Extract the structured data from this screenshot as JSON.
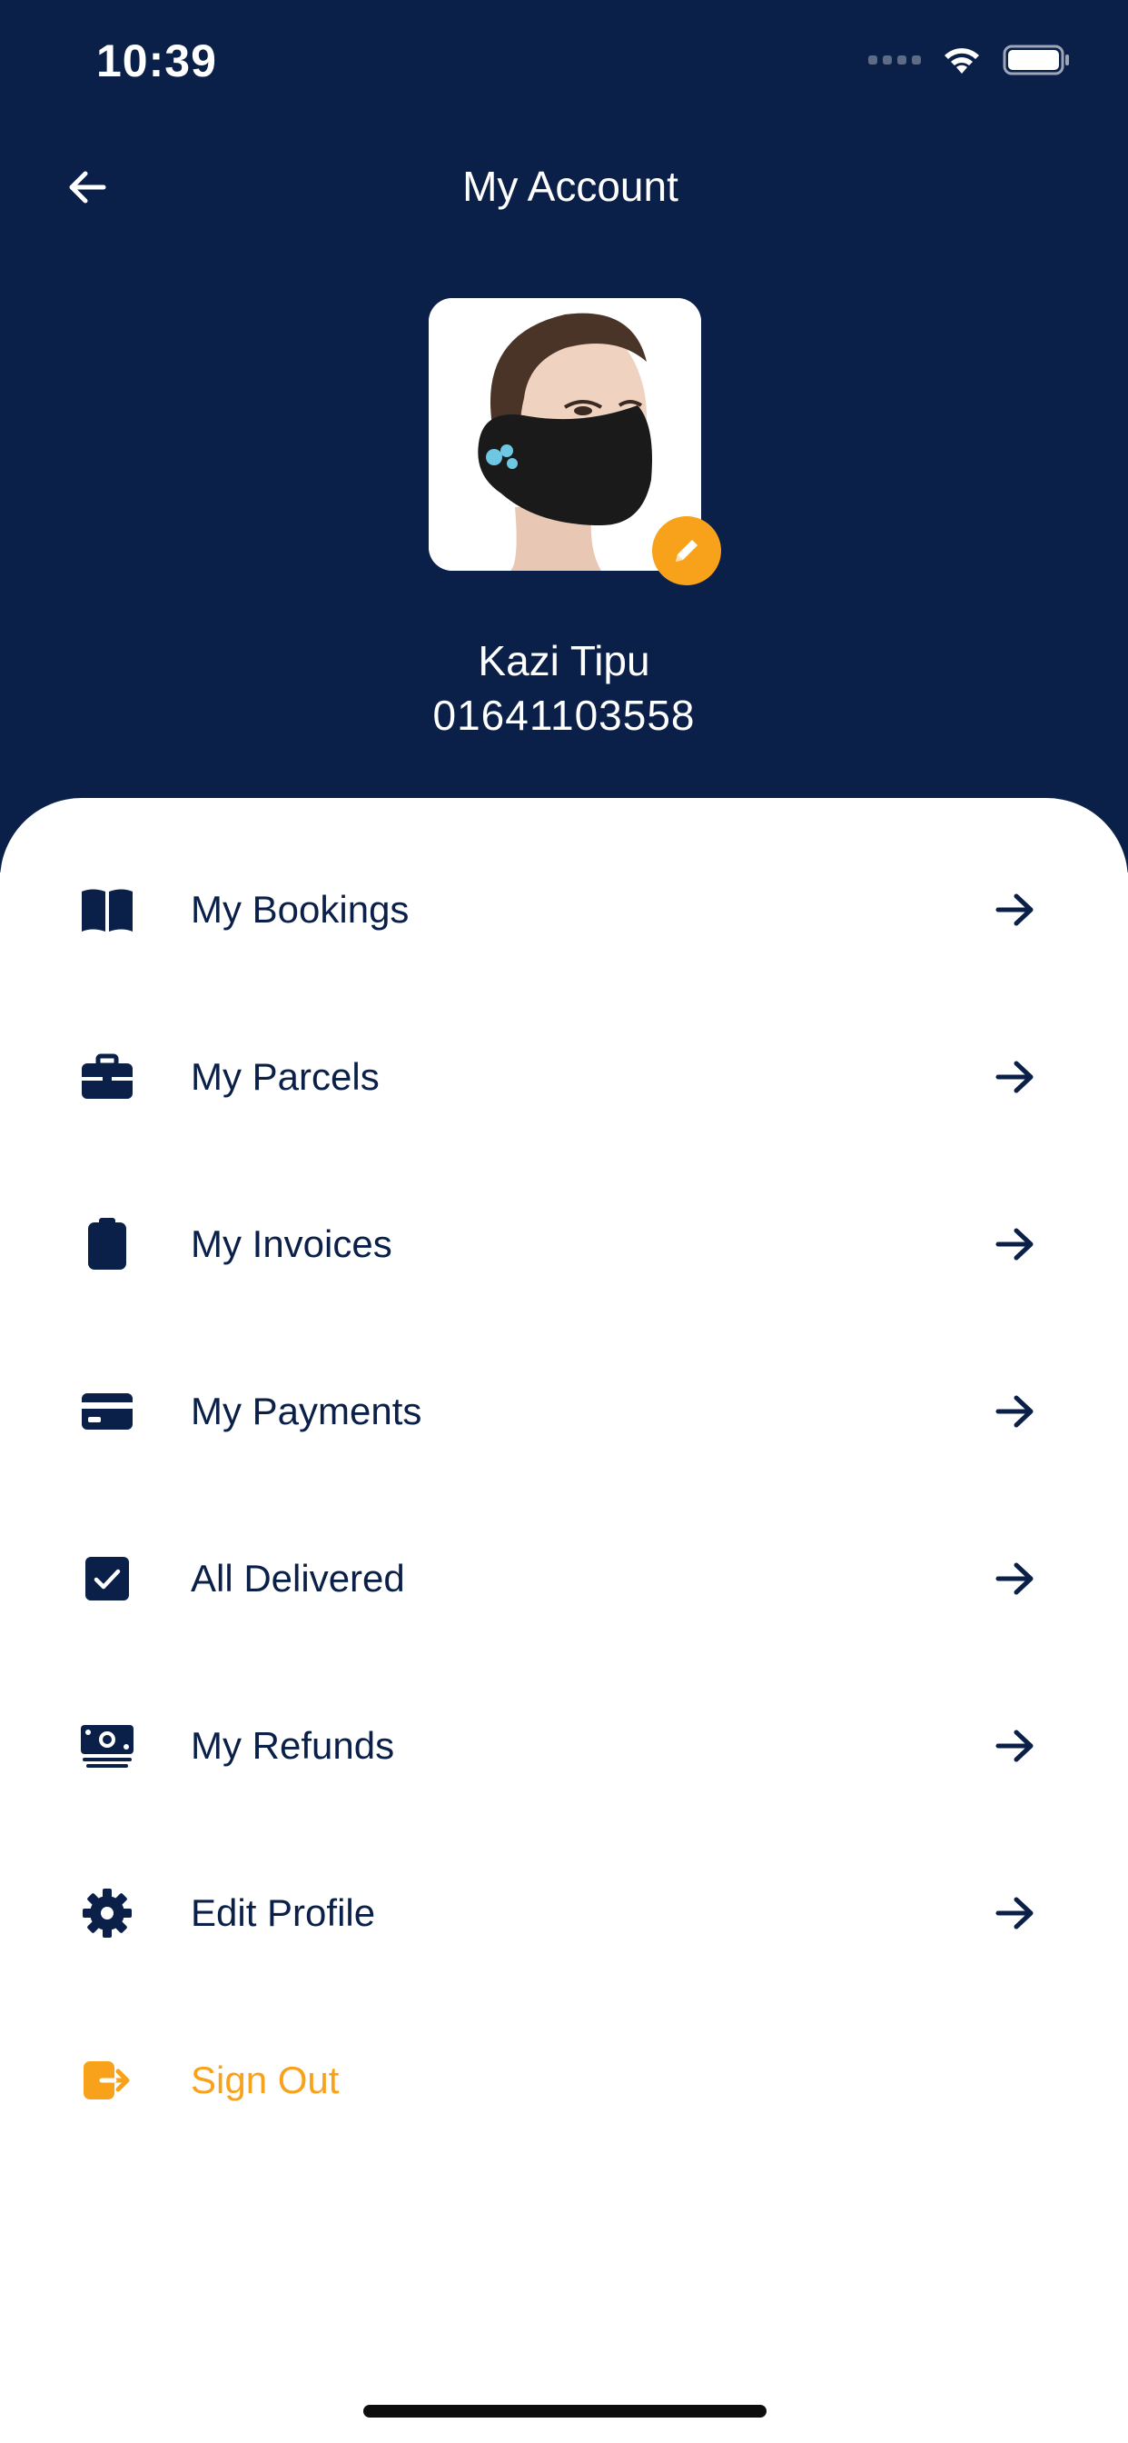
{
  "status_bar": {
    "time": "10:39"
  },
  "header": {
    "title": "My Account"
  },
  "profile": {
    "name": "Kazi Tipu",
    "phone": "01641103558"
  },
  "menu": [
    {
      "label": "My Bookings",
      "icon": "book-icon"
    },
    {
      "label": "My Parcels",
      "icon": "briefcase-icon"
    },
    {
      "label": "My Invoices",
      "icon": "clipboard-icon"
    },
    {
      "label": "My Payments",
      "icon": "credit-card-icon"
    },
    {
      "label": "All Delivered",
      "icon": "check-square-icon"
    },
    {
      "label": "My Refunds",
      "icon": "money-bill-icon"
    },
    {
      "label": "Edit Profile",
      "icon": "gear-icon"
    },
    {
      "label": "Sign Out",
      "icon": "sign-out-icon"
    }
  ],
  "colors": {
    "primary": "#0a2049",
    "accent": "#f8a21b",
    "background": "#ffffff"
  }
}
